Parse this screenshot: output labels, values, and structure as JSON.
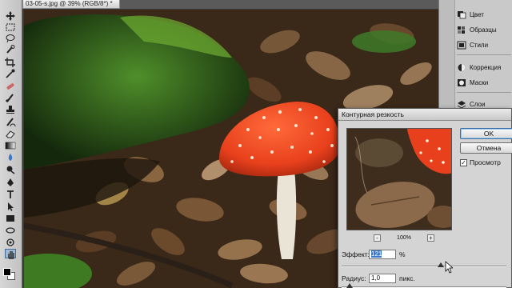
{
  "document": {
    "tab_title": "03-05-s.jpg @ 39% (RGB/8*) *"
  },
  "toolbar": {
    "tools": [
      "move-icon",
      "marquee-icon",
      "lasso-icon",
      "quick-select-icon",
      "crop-icon",
      "eyedropper-icon",
      "healing-icon",
      "brush-icon",
      "stamp-icon",
      "history-brush-icon",
      "eraser-icon",
      "gradient-icon",
      "blur-icon",
      "dodge-icon",
      "pen-icon",
      "type-icon",
      "path-select-icon",
      "shape-icon",
      "3d-rotate-icon",
      "3d-orbit-icon",
      "hand-icon",
      "zoom-icon"
    ]
  },
  "panels": {
    "items": [
      {
        "label": "Цвет",
        "icon": "color-icon"
      },
      {
        "label": "Образцы",
        "icon": "swatches-icon"
      },
      {
        "label": "Стили",
        "icon": "styles-icon"
      },
      {
        "label": "Коррекция",
        "icon": "adjustments-icon"
      },
      {
        "label": "Маски",
        "icon": "masks-icon"
      },
      {
        "label": "Слои",
        "icon": "layers-icon"
      }
    ]
  },
  "dialog": {
    "title": "Контурная резкость",
    "ok_label": "OK",
    "cancel_label": "Отмена",
    "preview_label": "Просмотр",
    "preview_checked": true,
    "zoom_level": "100%",
    "zoom_out": "-",
    "zoom_in": "+",
    "amount_label": "Эффект:",
    "amount_value": "121",
    "amount_unit": "%",
    "amount_slider_fraction": 0.6,
    "radius_label": "Радиус:",
    "radius_value": "1,0",
    "radius_unit": "пикс.",
    "radius_slider_fraction": 0.05
  }
}
